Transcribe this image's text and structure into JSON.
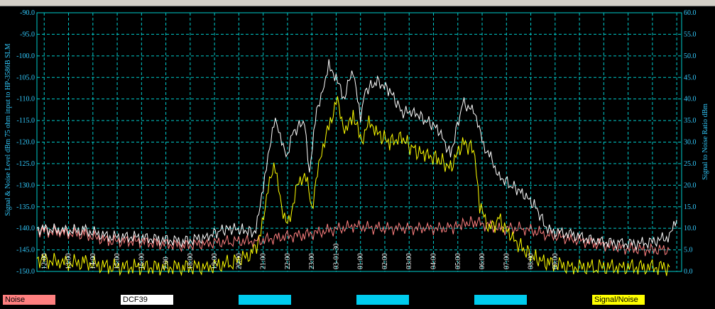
{
  "chart_data": {
    "type": "line",
    "ylabel_left": "Signal & Noise Level  dBm 75 ohm input to HP-3586B SLM",
    "ylabel_right": "Signal to Noise Ratio   dBm",
    "left_ticks": [
      "-90.0",
      "-95.0",
      "-100.0",
      "-105.0",
      "-110.0",
      "-115.0",
      "-120.0",
      "-125.0",
      "-130.0",
      "-135.0",
      "-140.0",
      "-145.0",
      "-150.0"
    ],
    "right_ticks": [
      "60.0",
      "55.0",
      "50.0",
      "45.0",
      "40.0",
      "35.0",
      "30.0",
      "25.0",
      "20.0",
      "15.0",
      "10.0",
      "5.0",
      "0.0"
    ],
    "ylim_left": [
      -150,
      -90
    ],
    "ylim_right": [
      0,
      60
    ],
    "x_ticks": [
      "12:00",
      "13:00",
      "14:00",
      "15:00",
      "16:00",
      "17:00",
      "18:00",
      "19:00",
      "20:00",
      "21:00",
      "22:00",
      "23:00",
      "03-01-30",
      "01:00",
      "02:00",
      "03:00",
      "04:00",
      "05:00",
      "06:00",
      "07:00",
      "08:00",
      "09:00",
      "10:00",
      "11:00",
      "12:00",
      "13:00",
      "14:00"
    ],
    "x_tick_labels_shown": [
      "12:00",
      "13:00",
      "14:00",
      "15:00",
      "16:00",
      "7:00",
      "18:00",
      "19:00",
      "20:00",
      "21:00",
      "22:00",
      "23:00",
      "03-01-30",
      "01:00",
      "02:00",
      "03:00",
      "04:00",
      "05:00",
      "06:00",
      "07:00",
      "08:00",
      "09:00",
      "",
      "",
      "",
      "",
      ""
    ],
    "x_hours": [
      0,
      26.5
    ],
    "grid": true,
    "series": [
      {
        "name": "Noise",
        "axis": "left",
        "color": "#ff8080",
        "points": [
          [
            0,
            -140.5
          ],
          [
            1,
            -141
          ],
          [
            2,
            -141.5
          ],
          [
            3,
            -143
          ],
          [
            4,
            -143
          ],
          [
            5,
            -143.5
          ],
          [
            6,
            -144
          ],
          [
            7,
            -143.5
          ],
          [
            8,
            -143
          ],
          [
            9,
            -143
          ],
          [
            10,
            -142
          ],
          [
            11,
            -141.5
          ],
          [
            12,
            -140.5
          ],
          [
            13,
            -139.5
          ],
          [
            14,
            -140
          ],
          [
            15,
            -140
          ],
          [
            16,
            -140
          ],
          [
            17,
            -140
          ],
          [
            17.5,
            -139
          ],
          [
            18,
            -138.5
          ],
          [
            19,
            -140
          ],
          [
            20,
            -140
          ],
          [
            21,
            -141.5
          ],
          [
            22,
            -142.5
          ],
          [
            23,
            -143.5
          ],
          [
            24,
            -144.5
          ],
          [
            25,
            -145
          ],
          [
            26,
            -145
          ]
        ]
      },
      {
        "name": "DCF39",
        "axis": "left",
        "color": "#ffffff",
        "points": [
          [
            0,
            -140
          ],
          [
            1,
            -140.5
          ],
          [
            2,
            -140.5
          ],
          [
            3,
            -142
          ],
          [
            4,
            -142
          ],
          [
            5,
            -142.5
          ],
          [
            6,
            -143
          ],
          [
            7,
            -142
          ],
          [
            7.5,
            -140.5
          ],
          [
            8,
            -140
          ],
          [
            8.5,
            -140.5
          ],
          [
            9,
            -141
          ],
          [
            9.3,
            -130
          ],
          [
            9.5,
            -123
          ],
          [
            9.8,
            -115
          ],
          [
            10,
            -118
          ],
          [
            10.3,
            -124
          ],
          [
            10.5,
            -118
          ],
          [
            11,
            -115
          ],
          [
            11.2,
            -128
          ],
          [
            11.5,
            -112
          ],
          [
            11.8,
            -108
          ],
          [
            12,
            -102
          ],
          [
            12.3,
            -105
          ],
          [
            12.6,
            -110
          ],
          [
            13,
            -103
          ],
          [
            13.3,
            -115
          ],
          [
            13.5,
            -108
          ],
          [
            14,
            -106
          ],
          [
            14.5,
            -108
          ],
          [
            15,
            -113
          ],
          [
            15.5,
            -113
          ],
          [
            16,
            -115
          ],
          [
            16.5,
            -117
          ],
          [
            17,
            -123
          ],
          [
            17.5,
            -111
          ],
          [
            18,
            -113
          ],
          [
            18.3,
            -120
          ],
          [
            18.6,
            -123
          ],
          [
            19,
            -128
          ],
          [
            19.5,
            -130
          ],
          [
            20,
            -132
          ],
          [
            20.5,
            -135
          ],
          [
            21,
            -140.5
          ],
          [
            22,
            -141.5
          ],
          [
            23,
            -143
          ],
          [
            24,
            -143.5
          ],
          [
            25,
            -143.5
          ],
          [
            26,
            -142
          ],
          [
            26.3,
            -138
          ]
        ]
      },
      {
        "name": "Signal/Noise",
        "axis": "right",
        "color": "#ffff00",
        "points": [
          [
            0,
            3
          ],
          [
            1,
            2
          ],
          [
            2,
            2
          ],
          [
            3,
            1
          ],
          [
            4,
            1
          ],
          [
            5,
            1
          ],
          [
            6,
            1
          ],
          [
            7,
            1
          ],
          [
            8,
            2
          ],
          [
            8.8,
            4
          ],
          [
            9.2,
            8
          ],
          [
            9.5,
            20
          ],
          [
            9.8,
            24
          ],
          [
            10,
            17
          ],
          [
            10.3,
            10
          ],
          [
            10.7,
            20
          ],
          [
            11,
            23
          ],
          [
            11.3,
            15
          ],
          [
            11.7,
            28
          ],
          [
            12,
            33
          ],
          [
            12.3,
            40
          ],
          [
            12.7,
            32
          ],
          [
            13,
            37
          ],
          [
            13.3,
            30
          ],
          [
            13.7,
            35
          ],
          [
            14,
            32
          ],
          [
            14.5,
            30
          ],
          [
            15,
            31
          ],
          [
            15.5,
            28
          ],
          [
            16,
            27
          ],
          [
            16.5,
            26
          ],
          [
            17,
            24
          ],
          [
            17.5,
            30
          ],
          [
            18,
            28
          ],
          [
            18.2,
            15
          ],
          [
            18.6,
            10
          ],
          [
            19,
            12
          ],
          [
            19.5,
            8
          ],
          [
            20,
            5
          ],
          [
            20.5,
            3
          ],
          [
            21,
            2
          ],
          [
            22,
            1
          ],
          [
            23,
            1
          ],
          [
            24,
            1
          ],
          [
            25,
            1
          ],
          [
            26,
            1
          ]
        ]
      }
    ]
  },
  "legend": {
    "noise_label": "Noise",
    "dcf39_label": "DCF39",
    "empty1_label": "",
    "empty2_label": "",
    "empty3_label": "",
    "sn_label": "Signal/Noise"
  },
  "colors": {
    "noise": "#ff8080",
    "dcf39": "#ffffff",
    "cyan_box": "#00ccee",
    "signal_noise": "#ffff00",
    "grid": "#00cccc",
    "axis_text": "#33ccff"
  }
}
